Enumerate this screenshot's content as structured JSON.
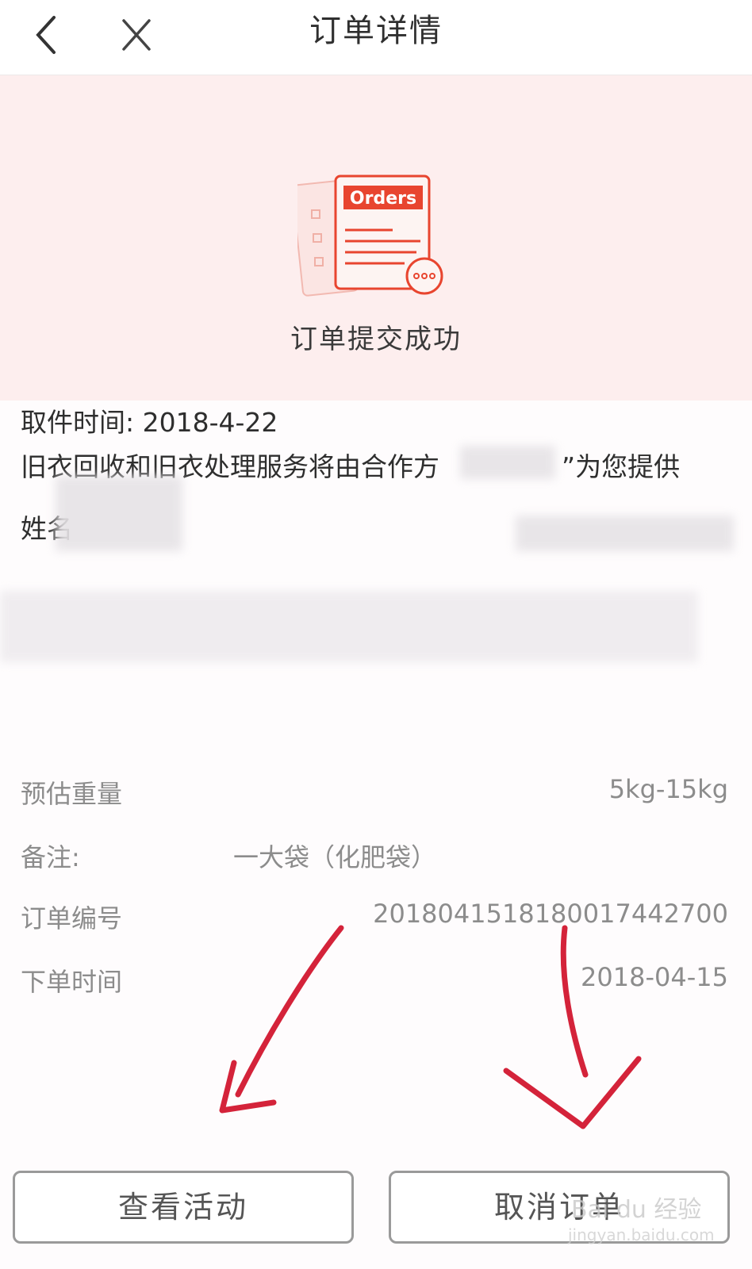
{
  "nav": {
    "title": "订单详情"
  },
  "hero": {
    "icon_label": "Orders",
    "status": "订单提交成功"
  },
  "pickup_time": "取件时间: 2018-4-22",
  "service_notice": "旧衣回收和旧衣处理服务将由合作方",
  "service_notice_end": "”为您提供",
  "name_label": "姓名",
  "details": {
    "weight_label": "预估重量",
    "weight_value": "5kg-15kg",
    "note_label": "备注:",
    "note_value": "一大袋（化肥袋）",
    "order_no_label": "订单编号",
    "order_no_value": "201804151818​0017442700",
    "order_time_label": "下单时间",
    "order_time_value": "2018-04-15"
  },
  "buttons": {
    "view_activity": "查看活动",
    "cancel_order": "取消订单"
  },
  "watermark": {
    "brand": "Bai du 经验",
    "url": "jingyan.baidu.com"
  },
  "colors": {
    "accent": "#e8452f",
    "hero_bg": "#fdeeee",
    "annotation": "#d4233a"
  }
}
